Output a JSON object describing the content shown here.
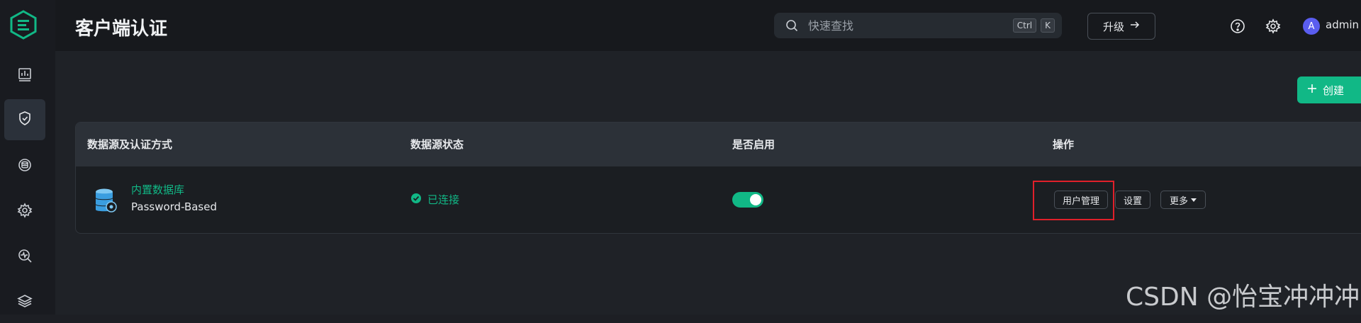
{
  "header": {
    "title": "客户端认证",
    "search_placeholder": "快速查找",
    "shortcut_ctrl": "Ctrl",
    "shortcut_k": "K",
    "upgrade_label": "升级",
    "avatar_letter": "A",
    "username": "admin"
  },
  "toolbar": {
    "create_label": "创建"
  },
  "table": {
    "columns": [
      "数据源及认证方式",
      "数据源状态",
      "是否启用",
      "操作"
    ],
    "rows": [
      {
        "name": "内置数据库",
        "auth": "Password-Based",
        "status": "已连接",
        "enabled": true,
        "actions": [
          "用户管理",
          "设置",
          "更多"
        ]
      }
    ]
  },
  "watermark": "CSDN @怡宝冲冲冲",
  "colors": {
    "accent": "#11b886",
    "highlight": "#e0202a",
    "avatar": "#5a5df0"
  },
  "icons": [
    "logo-icon",
    "dashboard-icon",
    "shield-icon",
    "database-icon",
    "gear-cog-icon",
    "monitor-icon",
    "layers-icon",
    "search-icon",
    "arrow-right-icon",
    "help-icon",
    "settings-icon",
    "plus-icon",
    "database-stack-icon",
    "check-circle-icon",
    "caret-down-icon"
  ]
}
